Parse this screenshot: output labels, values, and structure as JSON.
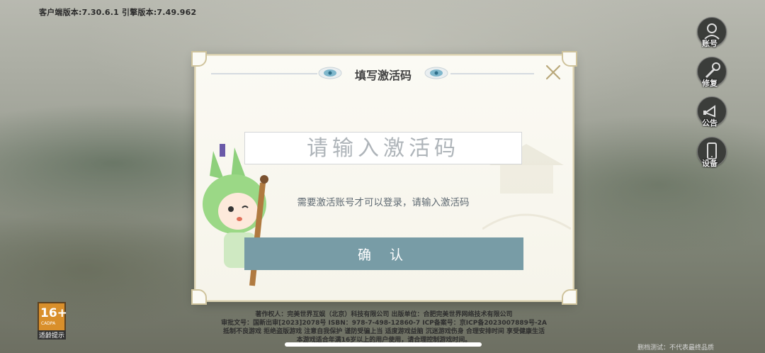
{
  "header": {
    "version_text": "客户端版本:7.30.6.1  引擎版本:7.49.962"
  },
  "side_menu": [
    {
      "label": "账号",
      "icon": "user-icon"
    },
    {
      "label": "修复",
      "icon": "wrench-icon"
    },
    {
      "label": "公告",
      "icon": "announcement-icon"
    },
    {
      "label": "设备",
      "icon": "phone-icon"
    }
  ],
  "dialog": {
    "title": "填写激活码",
    "input_placeholder": "请输入激活码",
    "input_value": "",
    "hint": "需要激活账号才可以登录，请输入激活码",
    "confirm_label": "确 认",
    "close_icon": "close-icon"
  },
  "age_rating": {
    "value": "16+",
    "org": "CADPA",
    "label": "适龄提示"
  },
  "footer": {
    "lines": [
      "著作权人：完美世界互娱（北京）科技有限公司 出版单位：合肥完美世界网络技术有限公司",
      "审批文号：国新出审[2023]2078号 ISBN：978-7-498-12860-7 ICP备案号：京ICP备2023007889号-2A",
      "抵制不良游戏 拒绝盗版游戏 注意自我保护 谨防受骗上当 适度游戏益脑 沉迷游戏伤身 合理安排时间 享受健康生活",
      "本游戏适合年满16岁以上的用户使用，请合理控制游戏时间。"
    ],
    "test_notice": "删档测试：不代表最终品质"
  },
  "colors": {
    "confirm_bg": "#789ca6",
    "dialog_bg": "#f6f4ea",
    "age_badge": "#d98f2b"
  }
}
